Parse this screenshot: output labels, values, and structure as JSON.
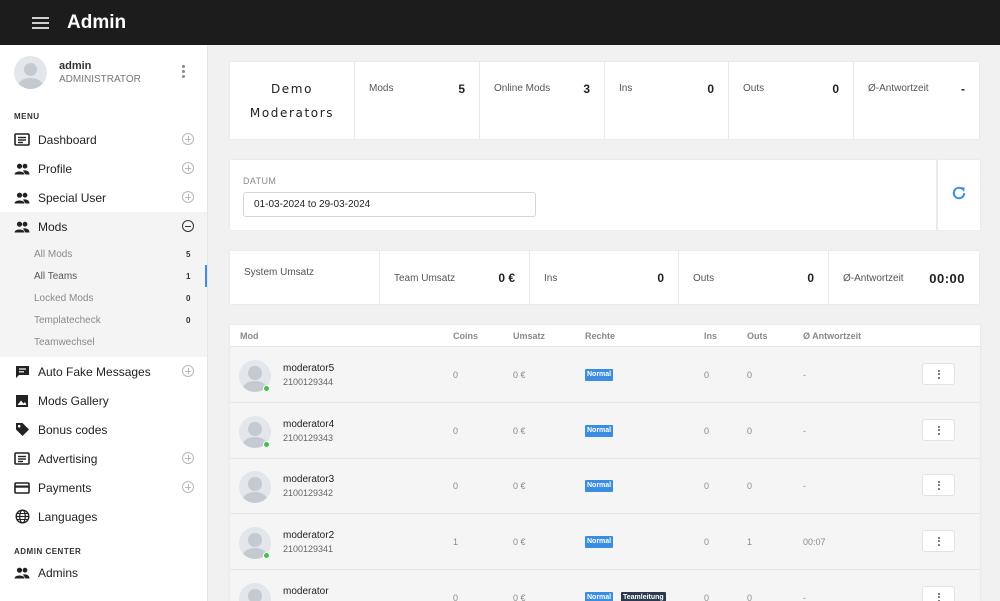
{
  "app": {
    "title": "Admin"
  },
  "user": {
    "name": "admin",
    "role": "ADMINISTRATOR"
  },
  "sidebar": {
    "menu_title": "MENU",
    "items": [
      {
        "label": "Dashboard",
        "icon": "dashboard-icon",
        "toggle": "plus"
      },
      {
        "label": "Profile",
        "icon": "users-icon",
        "toggle": "plus"
      },
      {
        "label": "Special User",
        "icon": "users-icon",
        "toggle": "plus"
      },
      {
        "label": "Mods",
        "icon": "users-icon",
        "toggle": "minus"
      },
      {
        "label": "Auto Fake Messages",
        "icon": "message-icon",
        "toggle": "plus"
      },
      {
        "label": "Mods Gallery",
        "icon": "image-icon",
        "toggle": "none"
      },
      {
        "label": "Bonus codes",
        "icon": "tag-icon",
        "toggle": "none"
      },
      {
        "label": "Advertising",
        "icon": "advertising-icon",
        "toggle": "plus"
      },
      {
        "label": "Payments",
        "icon": "credit-card-icon",
        "toggle": "plus"
      },
      {
        "label": "Languages",
        "icon": "globe-icon",
        "toggle": "none"
      }
    ],
    "submenu": [
      {
        "label": "All Mods",
        "count": "5"
      },
      {
        "label": "All Teams",
        "count": "1"
      },
      {
        "label": "Locked Mods",
        "count": "0"
      },
      {
        "label": "Templatecheck",
        "count": "0"
      },
      {
        "label": "Teamwechsel",
        "count": ""
      }
    ],
    "admin_title": "ADMIN CENTER",
    "admin_items": [
      {
        "label": "Admins",
        "icon": "users-icon"
      }
    ]
  },
  "stats": {
    "title_line1": "Demo",
    "title_line2": "Moderators",
    "mods_label": "Mods",
    "mods_value": "5",
    "online_label": "Online Mods",
    "online_value": "3",
    "ins_label": "Ins",
    "ins_value": "0",
    "outs_label": "Outs",
    "outs_value": "0",
    "avg_label": "Ø-Antwortzeit",
    "avg_value": "-"
  },
  "filter": {
    "label": "DATUM",
    "date_range": "01-03-2024 to 29-03-2024"
  },
  "revenue": {
    "system_label": "System Umsatz",
    "team_label": "Team Umsatz",
    "team_value": "0 €",
    "ins_label": "Ins",
    "ins_value": "0",
    "outs_label": "Outs",
    "outs_value": "0",
    "avg_label": "Ø-Antwortzeit",
    "avg_value": "00:00"
  },
  "table": {
    "headers": {
      "mod": "Mod",
      "coins": "Coins",
      "umsatz": "Umsatz",
      "rechte": "Rechte",
      "ins": "Ins",
      "outs": "Outs",
      "antwortzeit": "Ø Antwortzeit"
    },
    "rows": [
      {
        "name": "moderator5",
        "id": "2100129344",
        "online": true,
        "coins": "0",
        "umsatz": "0 €",
        "rights": [
          "Normal"
        ],
        "ins": "0",
        "outs": "0",
        "time": "-"
      },
      {
        "name": "moderator4",
        "id": "2100129343",
        "online": true,
        "coins": "0",
        "umsatz": "0 €",
        "rights": [
          "Normal"
        ],
        "ins": "0",
        "outs": "0",
        "time": "-"
      },
      {
        "name": "moderator3",
        "id": "2100129342",
        "online": false,
        "coins": "0",
        "umsatz": "0 €",
        "rights": [
          "Normal"
        ],
        "ins": "0",
        "outs": "0",
        "time": "-"
      },
      {
        "name": "moderator2",
        "id": "2100129341",
        "online": true,
        "coins": "1",
        "umsatz": "0 €",
        "rights": [
          "Normal"
        ],
        "ins": "0",
        "outs": "1",
        "time": "00:07"
      },
      {
        "name": "moderator",
        "id": "",
        "online": false,
        "coins": "0",
        "umsatz": "0 €",
        "rights": [
          "Normal",
          "Teamleitung"
        ],
        "ins": "0",
        "outs": "0",
        "time": "-"
      }
    ]
  },
  "colors": {
    "accent": "#3a8de0",
    "topbar": "#1c1c1c",
    "online": "#3fc34a",
    "lead_badge": "#2b3a4e"
  }
}
